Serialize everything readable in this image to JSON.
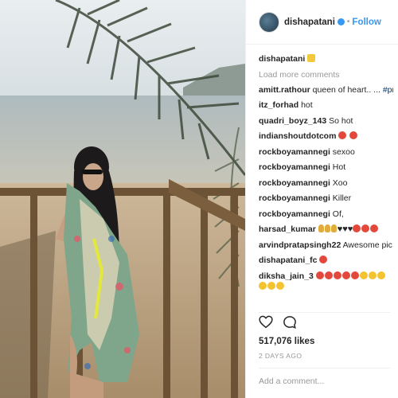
{
  "header": {
    "username": "dishapatani",
    "separator": "•",
    "follow_label": "Follow"
  },
  "comments": {
    "load_more": "Load more comments",
    "items": [
      {
        "user": "dishapatani",
        "text": ""
      },
      {
        "user": "amitt.rathour",
        "text": " queen of heart.. ... ",
        "tag": "#prfct"
      },
      {
        "user": "itz_forhad",
        "text": " hot"
      },
      {
        "user": "quadri_boyz_143",
        "text": " So hot"
      },
      {
        "user": "indianshoutdotcom",
        "text": " "
      },
      {
        "user": "rockboyamannegi",
        "text": " sexoo"
      },
      {
        "user": "rockboyamannegi",
        "text": " Hot"
      },
      {
        "user": "rockboyamannegi",
        "text": " Xoo"
      },
      {
        "user": "rockboyamannegi",
        "text": " Killer"
      },
      {
        "user": "rockboyamannegi",
        "text": " Of,"
      },
      {
        "user": "harsad_kumar",
        "text": " "
      },
      {
        "user": "arvindpratapsingh22",
        "text": " Awesome pic di"
      },
      {
        "user": "dishapatani_fc",
        "text": " "
      },
      {
        "user": "diksha_jain_3",
        "text": " "
      }
    ]
  },
  "actions": {
    "likes": "517,076 likes",
    "date": "2 DAYS AGO"
  },
  "add_comment": {
    "placeholder": "Add a comment..."
  },
  "colors": {
    "link": "#3897f0",
    "text": "#262626",
    "muted": "#999999",
    "hashtag": "#003569"
  },
  "icons": {
    "like": "heart-outline-icon",
    "comment": "speech-bubble-icon",
    "verified": "verified-badge-icon"
  }
}
